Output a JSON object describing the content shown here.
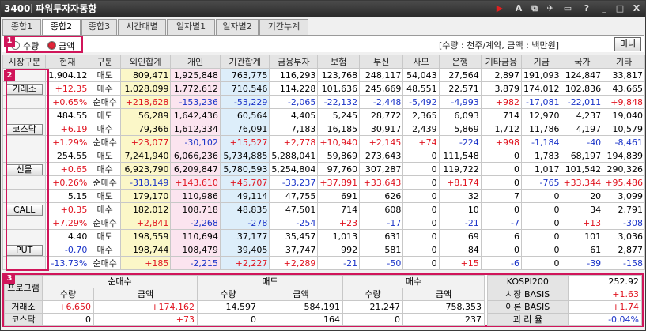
{
  "window": {
    "code": "3400",
    "title": "파워투자자동향"
  },
  "title_controls": [
    "▶",
    "A",
    "⧉",
    "✈",
    "▭",
    "?",
    "_",
    "□",
    "X"
  ],
  "tabs": [
    "종합1",
    "종합2",
    "종합3",
    "시간대별",
    "일자별1",
    "일자별2",
    "기간누계"
  ],
  "active_tab": 1,
  "options": {
    "qty_label": "수량",
    "amt_label": "금액",
    "selected": "amount"
  },
  "unit_note": "[수량 : 천주/계약, 금액 : 백만원]",
  "mini_button": "미니",
  "badges": [
    "1",
    "2",
    "3"
  ],
  "colors": {
    "up": "#e0121e",
    "down": "#1a33c8",
    "accent": "#d0155a"
  },
  "columns": [
    "시장구분",
    "현재",
    "구분",
    "외인합계",
    "개인",
    "기관합계",
    "금융투자",
    "보험",
    "투신",
    "사모",
    "은행",
    "기타금융",
    "기금",
    "국가",
    "기타"
  ],
  "markets": [
    {
      "name": "거래소",
      "rows": [
        {
          "cur": "1,904.12",
          "cd": "",
          "type": "매도",
          "vals": [
            "809,471",
            "1,925,848",
            "763,775",
            "116,293",
            "123,768",
            "248,117",
            "54,043",
            "27,564",
            "2,897",
            "191,093",
            "124,847",
            "33,817"
          ]
        },
        {
          "cur": "+12.35",
          "cd": "up",
          "type": "매수",
          "vals": [
            "1,028,099",
            "1,772,612",
            "710,546",
            "114,228",
            "101,636",
            "245,669",
            "48,551",
            "22,571",
            "3,879",
            "174,012",
            "102,836",
            "43,665"
          ]
        },
        {
          "cur": "+0.65%",
          "cd": "up",
          "type": "순매수",
          "vals": [
            "+218,628",
            "-153,236",
            "-53,229",
            "-2,065",
            "-22,132",
            "-2,448",
            "-5,492",
            "-4,993",
            "+982",
            "-17,081",
            "-22,011",
            "+9,848"
          ]
        }
      ]
    },
    {
      "name": "코스닥",
      "rows": [
        {
          "cur": "484.55",
          "cd": "",
          "type": "매도",
          "vals": [
            "56,289",
            "1,642,436",
            "60,564",
            "4,405",
            "5,245",
            "28,772",
            "2,365",
            "6,093",
            "714",
            "12,970",
            "4,237",
            "19,040"
          ]
        },
        {
          "cur": "+6.19",
          "cd": "up",
          "type": "매수",
          "vals": [
            "79,366",
            "1,612,334",
            "76,091",
            "7,183",
            "16,185",
            "30,917",
            "2,439",
            "5,869",
            "1,712",
            "11,786",
            "4,197",
            "10,579"
          ]
        },
        {
          "cur": "+1.29%",
          "cd": "up",
          "type": "순매수",
          "vals": [
            "+23,077",
            "-30,102",
            "+15,527",
            "+2,778",
            "+10,940",
            "+2,145",
            "+74",
            "-224",
            "+998",
            "-1,184",
            "-40",
            "-8,461"
          ]
        }
      ]
    },
    {
      "name": "선물",
      "rows": [
        {
          "cur": "254.55",
          "cd": "",
          "type": "매도",
          "vals": [
            "7,241,940",
            "6,066,236",
            "5,734,885",
            "5,288,041",
            "59,869",
            "273,643",
            "0",
            "111,548",
            "0",
            "1,783",
            "68,197",
            "194,839"
          ]
        },
        {
          "cur": "+0.65",
          "cd": "up",
          "type": "매수",
          "vals": [
            "6,923,790",
            "6,209,847",
            "5,780,593",
            "5,254,804",
            "97,760",
            "307,287",
            "0",
            "119,722",
            "0",
            "1,017",
            "101,542",
            "290,326"
          ]
        },
        {
          "cur": "+0.26%",
          "cd": "up",
          "type": "순매수",
          "vals": [
            "-318,149",
            "+143,610",
            "+45,707",
            "-33,237",
            "+37,891",
            "+33,643",
            "0",
            "+8,174",
            "0",
            "-765",
            "+33,344",
            "+95,486"
          ]
        }
      ]
    },
    {
      "name": "CALL",
      "rows": [
        {
          "cur": "5.15",
          "cd": "",
          "type": "매도",
          "vals": [
            "179,170",
            "110,986",
            "49,114",
            "47,755",
            "691",
            "626",
            "0",
            "32",
            "7",
            "0",
            "20",
            "3,099"
          ]
        },
        {
          "cur": "+0.35",
          "cd": "up",
          "type": "매수",
          "vals": [
            "182,012",
            "108,718",
            "48,835",
            "47,501",
            "714",
            "608",
            "0",
            "10",
            "0",
            "0",
            "34",
            "2,791"
          ]
        },
        {
          "cur": "+7.29%",
          "cd": "up",
          "type": "순매수",
          "vals": [
            "+2,841",
            "-2,268",
            "-278",
            "-254",
            "+23",
            "-17",
            "0",
            "-21",
            "-7",
            "0",
            "+13",
            "-308"
          ]
        }
      ]
    },
    {
      "name": "PUT",
      "rows": [
        {
          "cur": "4.40",
          "cd": "",
          "type": "매도",
          "vals": [
            "198,559",
            "110,694",
            "37,177",
            "35,457",
            "1,013",
            "631",
            "0",
            "69",
            "6",
            "0",
            "101",
            "3,036"
          ]
        },
        {
          "cur": "-0.70",
          "cd": "dn",
          "type": "매수",
          "vals": [
            "198,744",
            "108,479",
            "39,405",
            "37,747",
            "992",
            "581",
            "0",
            "84",
            "0",
            "0",
            "61",
            "2,877"
          ]
        },
        {
          "cur": "-13.73%",
          "cd": "dn",
          "type": "순매수",
          "vals": [
            "+185",
            "-2,215",
            "+2,227",
            "+2,289",
            "-21",
            "-50",
            "0",
            "+15",
            "-6",
            "0",
            "-39",
            "-158"
          ]
        }
      ]
    }
  ],
  "program": {
    "title": "프로그램",
    "groups": [
      "순매수",
      "매도",
      "매수"
    ],
    "sub": [
      "수량",
      "금액"
    ],
    "rows": [
      {
        "name": "거래소",
        "vals": [
          "+6,650",
          "+174,162",
          "14,597",
          "584,191",
          "21,247",
          "758,353"
        ]
      },
      {
        "name": "코스닥",
        "vals": [
          "0",
          "+73",
          "0",
          "164",
          "0",
          "237"
        ]
      }
    ]
  },
  "kospi": [
    {
      "label": "KOSPI200",
      "value": "252.92",
      "cd": ""
    },
    {
      "label": "시장 BASIS",
      "value": "+1.63",
      "cd": "up"
    },
    {
      "label": "이론 BASIS",
      "value": "+1.74",
      "cd": "up"
    },
    {
      "label": "괴 리 율",
      "value": "-0.04%",
      "cd": "dn"
    }
  ]
}
